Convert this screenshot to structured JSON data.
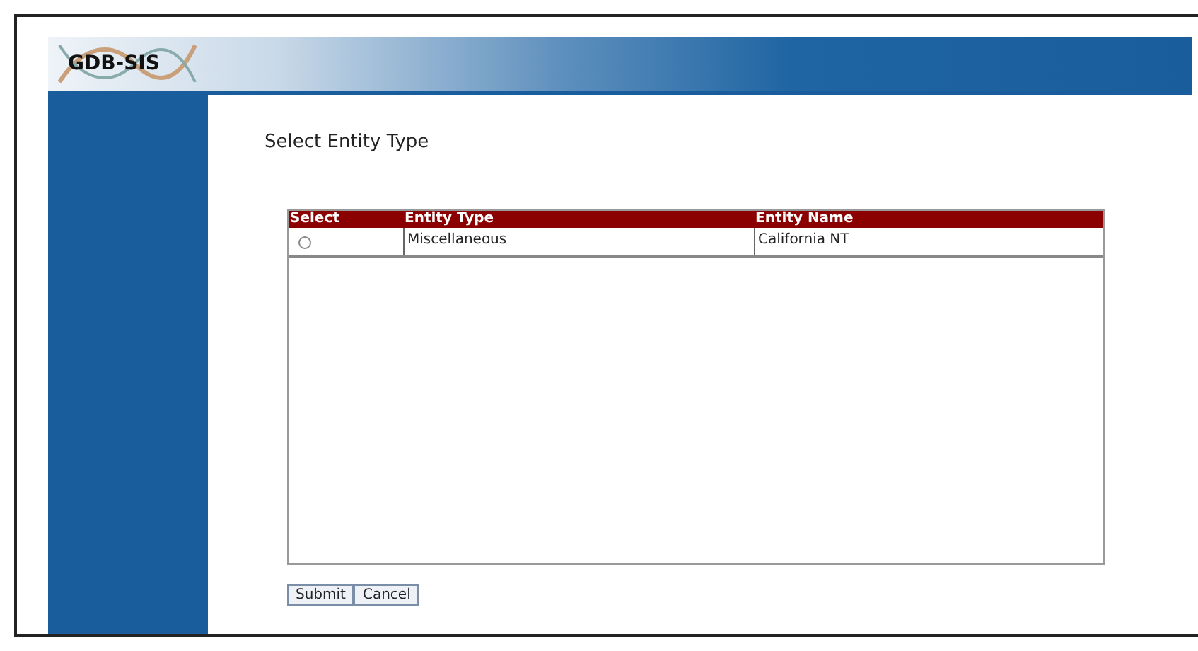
{
  "header": {
    "logo": "GDB-SIS"
  },
  "page_title": "Select Entity Type",
  "table": {
    "columns": [
      "Select",
      "Entity Type",
      "Entity Name"
    ],
    "rows": [
      {
        "selected": false,
        "cells": [
          "",
          "Miscellaneous",
          "California NT"
        ]
      }
    ]
  },
  "buttons": [
    "Submit",
    "Cancel"
  ]
}
